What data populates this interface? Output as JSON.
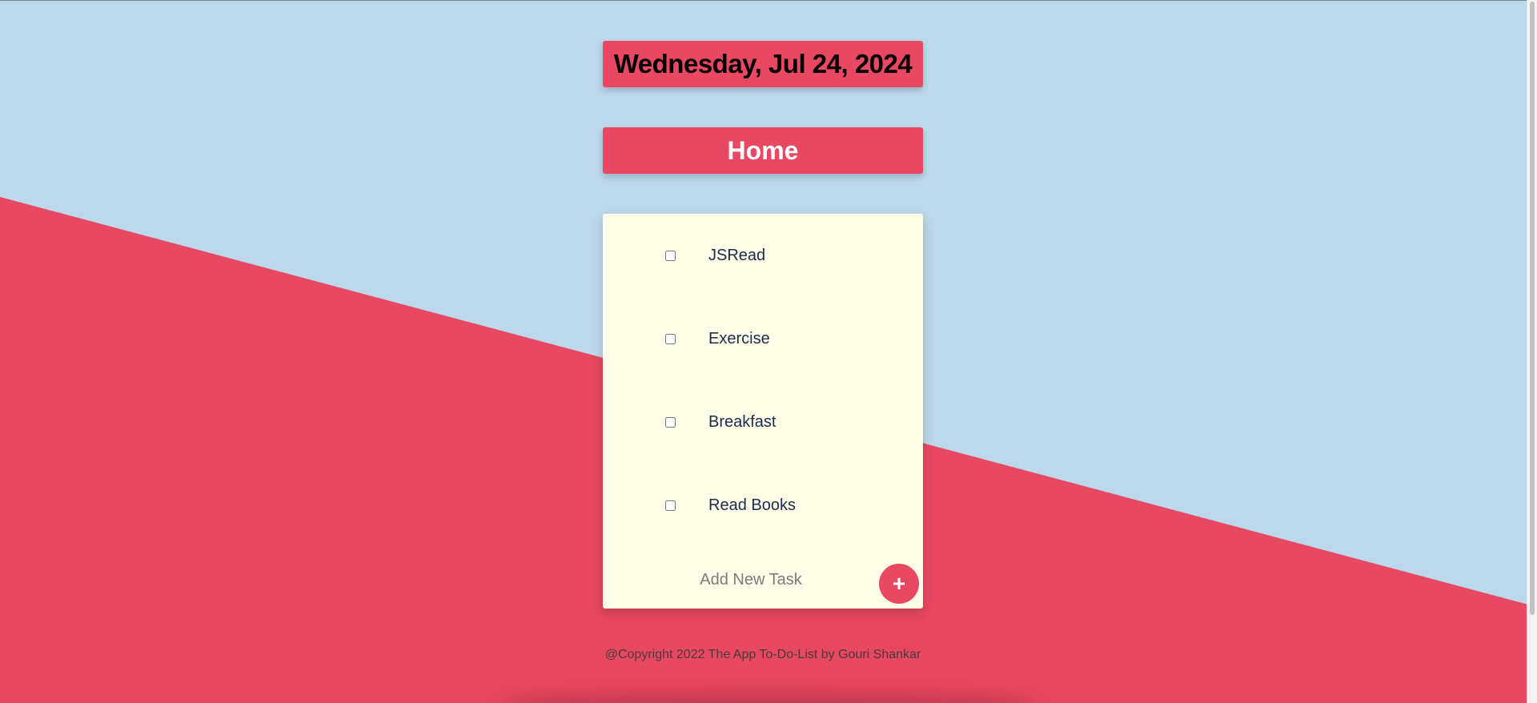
{
  "header": {
    "date": "Wednesday, Jul 24, 2024"
  },
  "list": {
    "title": "Home",
    "tasks": [
      {
        "label": "JSRead",
        "checked": false
      },
      {
        "label": "Exercise",
        "checked": false
      },
      {
        "label": "Breakfast",
        "checked": false
      },
      {
        "label": "Read Books",
        "checked": false
      }
    ]
  },
  "new_task": {
    "placeholder": "Add New Task",
    "button_label": "+",
    "button_icon": "plus-icon"
  },
  "footer": {
    "text": "@Copyright 2022 The App To-Do-List by Gouri Shankar"
  },
  "colors": {
    "background_top": "#bcd8ea",
    "background_bottom": "#e84862",
    "accent": "#e84862",
    "card": "#fefee9",
    "task_text": "#1c2b4e"
  }
}
